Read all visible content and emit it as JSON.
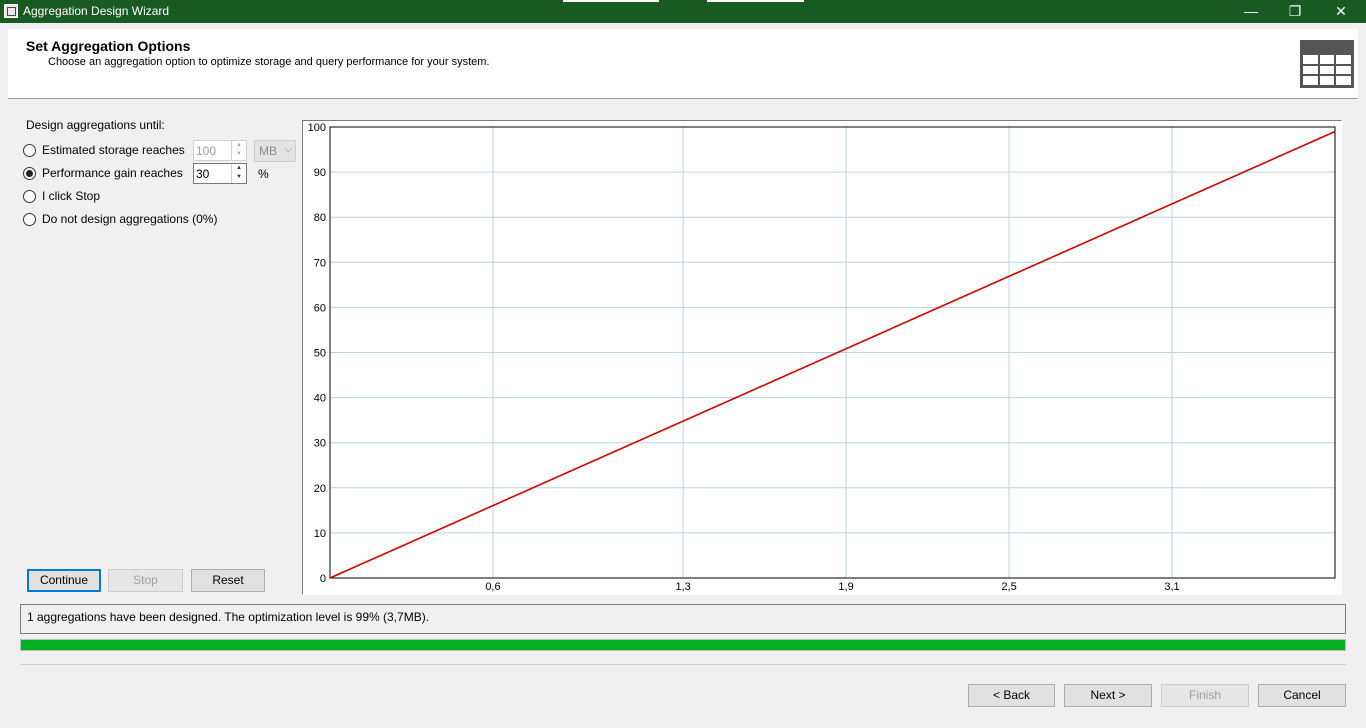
{
  "window": {
    "title": "Aggregation Design Wizard",
    "minimize_glyph": "—",
    "restore_glyph": "❐",
    "close_glyph": "✕",
    "title_bar_color": "#175a22"
  },
  "header": {
    "title": "Set Aggregation Options",
    "subtitle": "Choose an aggregation option to optimize storage and query performance for your system.",
    "icon": "table-grid-icon"
  },
  "options": {
    "caption": "Design aggregations until:",
    "radios": [
      {
        "label": "Estimated storage reaches",
        "checked": false
      },
      {
        "label": "Performance gain reaches",
        "checked": true
      },
      {
        "label": "I click Stop",
        "checked": false
      },
      {
        "label": "Do not design aggregations (0%)",
        "checked": false
      }
    ],
    "storage_value": "100",
    "storage_unit": "MB",
    "performance_value": "30",
    "performance_unit": "%"
  },
  "actions": {
    "continue": "Continue",
    "stop": "Stop",
    "reset": "Reset"
  },
  "chart_data": {
    "type": "line",
    "x_ticks": [
      "0,6",
      "1,3",
      "1,9",
      "2,5",
      "3,1"
    ],
    "y_ticks": [
      "0",
      "10",
      "20",
      "30",
      "40",
      "50",
      "60",
      "70",
      "80",
      "90",
      "100"
    ],
    "xlim": [
      0,
      3.7
    ],
    "ylim": [
      0,
      100
    ],
    "grid": true,
    "series": [
      {
        "color": "#d00000",
        "x": [
          0,
          3.7
        ],
        "y": [
          0,
          99
        ]
      }
    ]
  },
  "status": {
    "message": "1 aggregations have been designed. The optimization level is 99% (3,7MB).",
    "progress": 1.0,
    "progress_color": "#06b025"
  },
  "footer": {
    "back": "< Back",
    "next": "Next >",
    "finish": "Finish",
    "cancel": "Cancel"
  }
}
